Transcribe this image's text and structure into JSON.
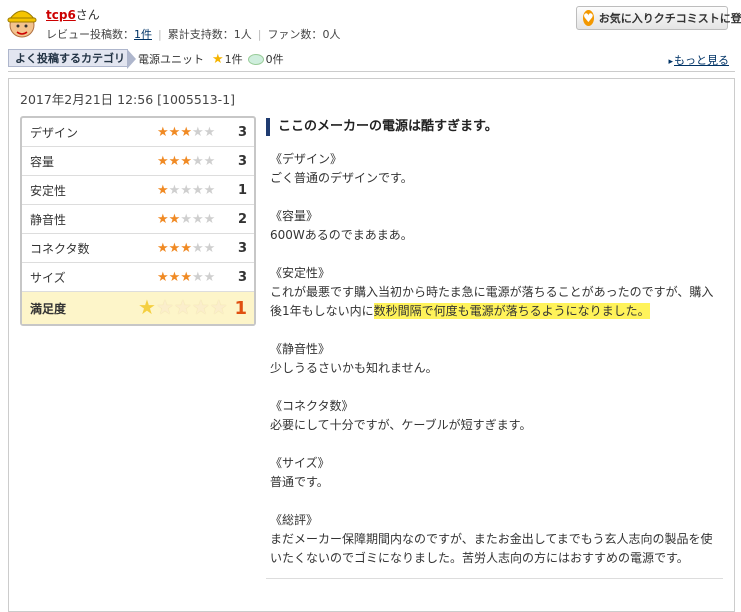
{
  "user": {
    "name": "tcp6",
    "suffix": "さん"
  },
  "stats": {
    "reviews_label": "レビュー投稿数：",
    "reviews_count": "1件",
    "support_label": "累計支持数：",
    "support_count": "1人",
    "fans_label": "ファン数：",
    "fans_count": "0人"
  },
  "favorite_button": "お気に入りクチコミストに登録",
  "category": {
    "tab_label": "よく投稿するカテゴリ",
    "name": "電源ユニット",
    "stars_count": "1件",
    "comments_count": "0件"
  },
  "more_link": "もっと見る",
  "review": {
    "date": "2017年2月21日 12:56 [1005513-1]",
    "ratings": [
      {
        "label": "デザイン",
        "value": "3",
        "filled": 3
      },
      {
        "label": "容量",
        "value": "3",
        "filled": 3
      },
      {
        "label": "安定性",
        "value": "1",
        "filled": 1
      },
      {
        "label": "静音性",
        "value": "2",
        "filled": 2
      },
      {
        "label": "コネクタ数",
        "value": "3",
        "filled": 3
      },
      {
        "label": "サイズ",
        "value": "3",
        "filled": 3
      }
    ],
    "satisfaction": {
      "label": "満足度",
      "value": "1",
      "filled": 1
    },
    "title": "ここのメーカーの電源は酷すぎます。",
    "sections": [
      {
        "heading": "《デザイン》",
        "text": "ごく普通のデザインです。"
      },
      {
        "heading": "《容量》",
        "text": "600Wあるのでまあまあ。"
      },
      {
        "heading": "《安定性》",
        "text": "これが最悪です購入当初から時たま急に電源が落ちることがあったのですが、購入後1年もしない内に",
        "highlight": "数秒間隔で何度も電源が落ちるようになりました。"
      },
      {
        "heading": "《静音性》",
        "text": "少しうるさいかも知れません。"
      },
      {
        "heading": "《コネクタ数》",
        "text": "必要にして十分ですが、ケーブルが短すぎます。"
      },
      {
        "heading": "《サイズ》",
        "text": "普通です。"
      },
      {
        "heading": "《総評》",
        "text": "まだメーカー保障期間内なのですが、またお金出してまでもう玄人志向の製品を使いたくないのでゴミになりました。苦労人志向の方にはおすすめの電源です。"
      }
    ]
  }
}
